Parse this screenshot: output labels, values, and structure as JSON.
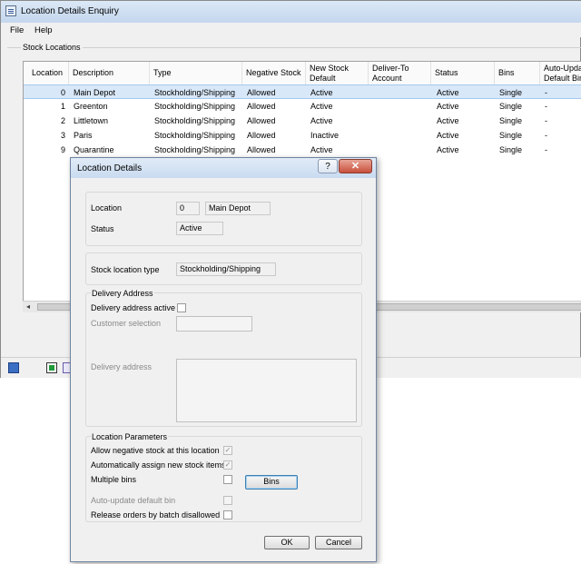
{
  "window": {
    "title": "Location Details Enquiry"
  },
  "menu": [
    {
      "label": "File"
    },
    {
      "label": "Help"
    }
  ],
  "stock_locations": {
    "group_label": "Stock Locations",
    "columns": [
      "Location",
      "Description",
      "Type",
      "Negative Stock",
      "New Stock Default",
      "Deliver-To Account",
      "Status",
      "Bins",
      "Auto-Update Default Bin"
    ],
    "rows": [
      {
        "location": "0",
        "description": "Main Depot",
        "type": "Stockholding/Shipping",
        "negative": "Allowed",
        "new_default": "Active",
        "deliver_to": "",
        "status": "Active",
        "bins": "Single",
        "auto": "-"
      },
      {
        "location": "1",
        "description": "Greenton",
        "type": "Stockholding/Shipping",
        "negative": "Allowed",
        "new_default": "Active",
        "deliver_to": "",
        "status": "Active",
        "bins": "Single",
        "auto": "-"
      },
      {
        "location": "2",
        "description": "Littletown",
        "type": "Stockholding/Shipping",
        "negative": "Allowed",
        "new_default": "Active",
        "deliver_to": "",
        "status": "Active",
        "bins": "Single",
        "auto": "-"
      },
      {
        "location": "3",
        "description": "Paris",
        "type": "Stockholding/Shipping",
        "negative": "Allowed",
        "new_default": "Inactive",
        "deliver_to": "",
        "status": "Active",
        "bins": "Single",
        "auto": "-"
      },
      {
        "location": "9",
        "description": "Quarantine",
        "type": "Stockholding/Shipping",
        "negative": "Allowed",
        "new_default": "Active",
        "deliver_to": "",
        "status": "Active",
        "bins": "Single",
        "auto": "-"
      }
    ]
  },
  "dialog": {
    "title": "Location Details",
    "help": "?",
    "close": "✕",
    "location_label": "Location",
    "location_code": "0",
    "location_name": "Main Depot",
    "status_label": "Status",
    "status_value": "Active",
    "stock_type_label": "Stock location type",
    "stock_type_value": "Stockholding/Shipping",
    "delivery_group": "Delivery Address",
    "delivery_active_label": "Delivery address active",
    "delivery_active": false,
    "customer_selection_label": "Customer selection",
    "delivery_address_label": "Delivery address",
    "params_group": "Location Parameters",
    "params": [
      {
        "label": "Allow negative stock at this location",
        "checked": true,
        "enabled": false
      },
      {
        "label": "Automatically assign new stock items",
        "checked": true,
        "enabled": false
      },
      {
        "label": "Multiple bins",
        "checked": false,
        "enabled": true
      },
      {
        "label": "Auto-update default bin",
        "checked": false,
        "enabled": false
      },
      {
        "label": "Release orders by batch disallowed",
        "checked": false,
        "enabled": true
      }
    ],
    "bins_button": "Bins",
    "ok_button": "OK",
    "cancel_button": "Cancel"
  },
  "colors": {
    "selection": "#d9e8f9",
    "titlebar": "#c4d7ee",
    "close": "#c8503c"
  }
}
